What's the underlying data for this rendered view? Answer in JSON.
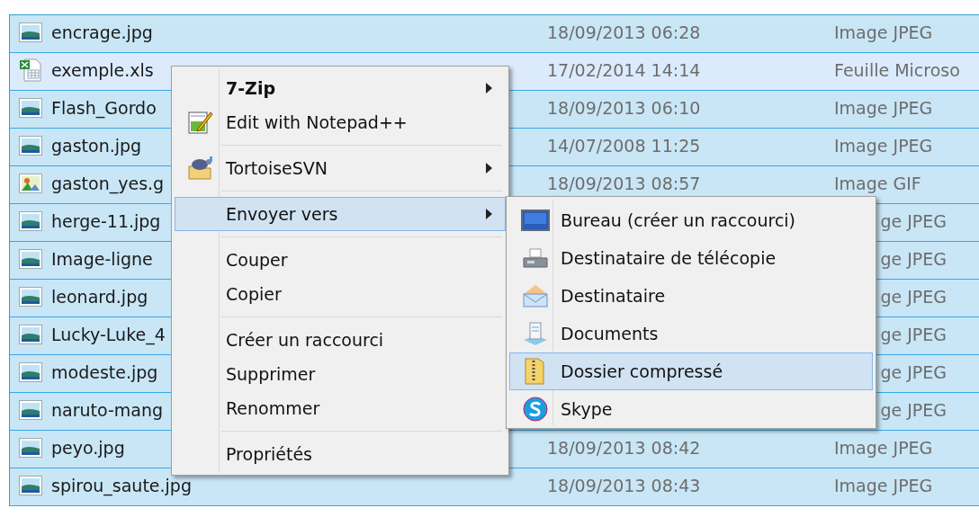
{
  "files": [
    {
      "kind": "jpeg",
      "name": "encrage.jpg",
      "date": "18/09/2013 06:28",
      "type": "Image JPEG",
      "selected": true,
      "focused": false,
      "partly_hidden": false
    },
    {
      "kind": "xls",
      "name": "exemple.xls",
      "date": "17/02/2014 14:14",
      "type": "Feuille Microso",
      "selected": true,
      "focused": true,
      "partly_hidden": false
    },
    {
      "kind": "jpeg",
      "name": "Flash_Gordo",
      "date": "18/09/2013 06:10",
      "type": "Image JPEG",
      "selected": true,
      "focused": false,
      "partly_hidden": false
    },
    {
      "kind": "jpeg",
      "name": "gaston.jpg",
      "date": "14/07/2008 11:25",
      "type": "Image JPEG",
      "selected": true,
      "focused": false,
      "partly_hidden": false
    },
    {
      "kind": "gif",
      "name": "gaston_yes.g",
      "date": "18/09/2013 08:57",
      "type": "Image GIF",
      "selected": true,
      "focused": false,
      "partly_hidden": false
    },
    {
      "kind": "jpeg",
      "name": "herge-11.jpg",
      "type": "ge JPEG",
      "selected": true,
      "focused": false,
      "partly_hidden": true
    },
    {
      "kind": "jpeg",
      "name": "Image-ligne",
      "type": "ge JPEG",
      "selected": true,
      "focused": false,
      "partly_hidden": true
    },
    {
      "kind": "jpeg",
      "name": "leonard.jpg",
      "type": "ge JPEG",
      "selected": true,
      "focused": false,
      "partly_hidden": true
    },
    {
      "kind": "jpeg",
      "name": "Lucky-Luke_4",
      "type": "ge JPEG",
      "selected": true,
      "focused": false,
      "partly_hidden": true
    },
    {
      "kind": "jpeg",
      "name": "modeste.jpg",
      "type": "ge JPEG",
      "selected": true,
      "focused": false,
      "partly_hidden": true
    },
    {
      "kind": "jpeg",
      "name": "naruto-mang",
      "type": "ge JPEG",
      "selected": true,
      "focused": false,
      "partly_hidden": true
    },
    {
      "kind": "jpeg",
      "name": "peyo.jpg",
      "date": "18/09/2013 08:42",
      "type": "Image JPEG",
      "selected": true,
      "focused": false,
      "partly_hidden": false
    },
    {
      "kind": "jpeg",
      "name": "spirou_saute.jpg",
      "date": "18/09/2013 08:43",
      "type": "Image JPEG",
      "selected": true,
      "focused": false,
      "partly_hidden": false
    }
  ],
  "context_menu": [
    {
      "kind": "item",
      "label": "7-Zip",
      "bold": true,
      "submenu": true,
      "selected": false
    },
    {
      "kind": "item",
      "label": "Edit with Notepad++",
      "bold": false,
      "submenu": false,
      "selected": false
    },
    {
      "kind": "separator"
    },
    {
      "kind": "item",
      "label": "TortoiseSVN",
      "bold": false,
      "submenu": true,
      "selected": false
    },
    {
      "kind": "separator"
    },
    {
      "kind": "item",
      "label": "Envoyer vers",
      "bold": false,
      "submenu": true,
      "selected": true
    },
    {
      "kind": "separator"
    },
    {
      "kind": "item",
      "label": "Couper",
      "bold": false,
      "submenu": false,
      "selected": false
    },
    {
      "kind": "item",
      "label": "Copier",
      "bold": false,
      "submenu": false,
      "selected": false
    },
    {
      "kind": "separator"
    },
    {
      "kind": "item",
      "label": "Créer un raccourci",
      "bold": false,
      "submenu": false,
      "selected": false
    },
    {
      "kind": "item",
      "label": "Supprimer",
      "bold": false,
      "submenu": false,
      "selected": false
    },
    {
      "kind": "item",
      "label": "Renommer",
      "bold": false,
      "submenu": false,
      "selected": false
    },
    {
      "kind": "separator"
    },
    {
      "kind": "item",
      "label": "Propriétés",
      "bold": false,
      "submenu": false,
      "selected": false
    }
  ],
  "send_to_menu": [
    {
      "label": "Bureau (créer un raccourci)",
      "selected": false
    },
    {
      "label": "Destinataire de télécopie",
      "selected": false
    },
    {
      "label": "Destinataire",
      "selected": false
    },
    {
      "label": "Documents",
      "selected": false
    },
    {
      "label": "Dossier compressé",
      "selected": true
    },
    {
      "label": "Skype",
      "selected": false
    }
  ]
}
